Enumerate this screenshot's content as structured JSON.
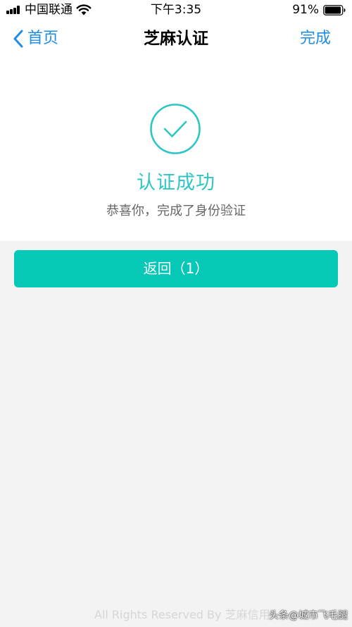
{
  "status_bar": {
    "carrier": "中国联通",
    "time": "下午3:35",
    "battery": "91%",
    "signal_icon": "cellular-signal-icon",
    "wifi_icon": "wifi-icon",
    "battery_icon": "battery-icon"
  },
  "nav": {
    "back_label": "首页",
    "title": "芝麻认证",
    "done_label": "完成",
    "accent_color": "#1f8de3"
  },
  "result": {
    "icon": "check-circle-icon",
    "title": "认证成功",
    "subtitle": "恭喜你，完成了身份验证",
    "accent_color": "#2ec6c4"
  },
  "actions": {
    "return_label": "返回（1）",
    "button_color": "#06c8b7"
  },
  "footer": {
    "copyright": "All Rights Reserved By 芝麻信用",
    "watermark": "头条@城市飞毛腿"
  }
}
